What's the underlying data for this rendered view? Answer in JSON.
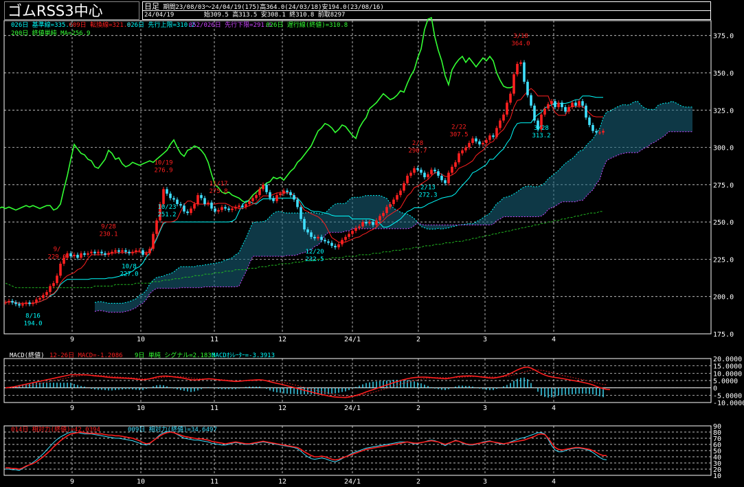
{
  "header": {
    "title": "ゴムRSS3中心",
    "period_type": "日足",
    "info": "期間23/08/03～24/04/19(175)高364.0(24/03/18)安194.0(23/08/16)",
    "date": "24/04/19",
    "ohlc": "始309.5 高313.5 安308.1 終310.8 前取8297"
  },
  "colors": {
    "background": "#000000",
    "up": "#ff2020",
    "down": "#40e0ff",
    "kijun": "#00ffff",
    "tenkan": "#ff2020",
    "senkou_a": "#00ffff",
    "senkou_b": "#cc44ff",
    "chikou": "#33ff33",
    "ma200": "#22bb22",
    "macd": "#ff2020",
    "signal": "#cc2222",
    "histogram": "#40e0ff",
    "rsi14": "#ff2020",
    "rsi9": "#40e0ff",
    "grid": "#ffffff"
  },
  "legend": {
    "l1": [
      "026日 基準線=335.6",
      "009日 転換線=321.0",
      "026日 先行上限=310.2",
      "052/026日 先行下限=291.6",
      "026日 遅行線(終値)=310.8"
    ],
    "l2": "200日 終値単純 MA=256.9",
    "macd": [
      "MACD(終値)",
      "12-26日 MACD=-1.2086",
      "9日 単純 シグナル=2.1833",
      "MACDｵｼﾚｰﾀｰ=-3.3913"
    ],
    "rsi": [
      "014日 相対力(終値)=42.0394",
      "009日 相対力(終値)=34.6497"
    ]
  },
  "chart_data": [
    {
      "type": "candlestick",
      "title": "ゴムRSS3中心",
      "ylim": [
        175,
        385
      ],
      "y_ticks": [
        "375.0",
        "350.0",
        "325.0",
        "300.0",
        "275.0",
        "250.0",
        "225.0",
        "200.0",
        "175.0"
      ],
      "x_ticks": [
        "9",
        "10",
        "11",
        "12",
        "24/1",
        "2",
        "3",
        "4"
      ],
      "annotations": [
        {
          "date": "8/16",
          "value": "194.0"
        },
        {
          "date": "9/",
          "value": "229.0"
        },
        {
          "date": "9/28",
          "value": "230.1"
        },
        {
          "date": "10/8",
          "value": "227.0"
        },
        {
          "date": "10/19",
          "value": "276.9"
        },
        {
          "date": "10/23",
          "value": "251.2"
        },
        {
          "date": "11/17",
          "value": "275.8"
        },
        {
          "date": "12/20",
          "value": "232.5"
        },
        {
          "date": "2/8",
          "value": "290.7"
        },
        {
          "date": "2/13",
          "value": "272.3"
        },
        {
          "date": "2/22",
          "value": "307.5"
        },
        {
          "date": "3/18",
          "value": "364.0"
        },
        {
          "date": "3/28",
          "value": "313.2"
        }
      ],
      "close": [
        196,
        197,
        196,
        195,
        194,
        195,
        196,
        195,
        196,
        198,
        199,
        201,
        203,
        207,
        209,
        214,
        222,
        226,
        229,
        227,
        228,
        226,
        229,
        228,
        229,
        230,
        229,
        230,
        229,
        228,
        229,
        230,
        231,
        230,
        231,
        230,
        229,
        230,
        231,
        231,
        228,
        229,
        232,
        242,
        251,
        262,
        272,
        269,
        266,
        265,
        262,
        261,
        257,
        256,
        259,
        262,
        268,
        266,
        262,
        263,
        259,
        257,
        258,
        260,
        259,
        258,
        259,
        260,
        261,
        260,
        262,
        264,
        266,
        268,
        272,
        275,
        270,
        266,
        264,
        268,
        269,
        271,
        270,
        268,
        265,
        260,
        252,
        245,
        243,
        240,
        239,
        240,
        238,
        237,
        236,
        234,
        233,
        235,
        238,
        240,
        242,
        244,
        246,
        247,
        250,
        249,
        250,
        248,
        251,
        254,
        256,
        260,
        262,
        265,
        268,
        271,
        276,
        281,
        283,
        286,
        285,
        283,
        280,
        282,
        285,
        284,
        281,
        278,
        276,
        283,
        287,
        290,
        296,
        298,
        300,
        303,
        306,
        304,
        302,
        303,
        305,
        308,
        307,
        313,
        318,
        322,
        330,
        336,
        349,
        356,
        357,
        344,
        335,
        328,
        318,
        312,
        322,
        326,
        329,
        331,
        327,
        330,
        327,
        324,
        327,
        330,
        328,
        331,
        328,
        320,
        315,
        311,
        310,
        310,
        311
      ],
      "ma200": [
        209,
        208,
        207,
        206,
        206,
        206,
        206,
        206,
        206,
        206,
        206,
        206,
        206,
        206,
        206,
        206,
        206,
        206,
        206,
        206,
        206,
        206,
        206,
        206,
        206,
        206,
        207,
        207,
        207,
        207,
        207,
        207,
        208,
        208,
        208,
        208,
        208,
        208,
        209,
        209,
        209,
        209,
        209,
        210,
        210,
        210,
        211,
        211,
        211,
        212,
        212,
        212,
        213,
        213,
        213,
        214,
        214,
        214,
        215,
        215,
        215,
        216,
        216,
        216,
        217,
        217,
        217,
        218,
        218,
        218,
        218,
        219,
        219,
        219,
        220,
        220,
        220,
        221,
        221,
        221,
        222,
        222,
        222,
        222,
        223,
        223,
        223,
        224,
        224,
        224,
        224,
        225,
        225,
        225,
        225,
        226,
        226,
        226,
        226,
        227,
        227,
        227,
        227,
        228,
        228,
        228,
        228,
        229,
        229,
        229,
        230,
        230,
        230,
        231,
        231,
        231,
        232,
        232,
        232,
        233,
        233,
        233,
        234,
        234,
        234,
        235,
        235,
        235,
        236,
        236,
        236,
        237,
        237,
        237,
        238,
        238,
        239,
        239,
        240,
        240,
        241,
        241,
        242,
        242,
        243,
        243,
        244,
        244,
        245,
        245,
        246,
        246,
        247,
        247,
        248,
        248,
        249,
        249,
        250,
        250,
        251,
        251,
        252,
        252,
        253,
        253,
        254,
        254,
        255,
        255,
        256,
        256,
        256,
        257,
        257
      ]
    },
    {
      "type": "line",
      "title": "MACD(終値)",
      "ylim": [
        -10,
        20
      ],
      "y_ticks": [
        "20.0000",
        "15.0000",
        "10.0000",
        "5.0000",
        "0",
        "-5.0000",
        "-10.0000"
      ],
      "series": [
        {
          "name": "MACD",
          "values": [
            0,
            0.3,
            0.6,
            1,
            1.5,
            2,
            2.5,
            3,
            3.5,
            4,
            4.5,
            5,
            5.5,
            6,
            6.5,
            7,
            7.5,
            8,
            8.5,
            9,
            9,
            9,
            9,
            9,
            8.8,
            8.5,
            8.2,
            8,
            7.8,
            7.5,
            7.2,
            7,
            6.9,
            6.8,
            6.7,
            6.6,
            6.5,
            6.3,
            6,
            5.7,
            5.5,
            5.8,
            6.2,
            6.8,
            7.4,
            7.8,
            8,
            8,
            7.8,
            7.5,
            7.2,
            6.9,
            6.5,
            6,
            5.5,
            5.4,
            5.5,
            5.7,
            6,
            6.2,
            6.1,
            5.8,
            5.5,
            5.2,
            5,
            4.8,
            4.6,
            4.4,
            4.5,
            4.7,
            5,
            5.2,
            5.3,
            5.4,
            5.5,
            5.3,
            4.8,
            4.2,
            3.6,
            3.1,
            2.6,
            2,
            1.4,
            0.8,
            0.2,
            -0.4,
            -1,
            -1.6,
            -2.2,
            -2.8,
            -3.4,
            -4,
            -4.5,
            -5,
            -5.5,
            -5.9,
            -6.2,
            -6.4,
            -6.5,
            -6.6,
            -6.3,
            -5.8,
            -5.2,
            -4.5,
            -3.7,
            -2.8,
            -2,
            -1.2,
            -0.4,
            0.4,
            1.2,
            2,
            2.8,
            3.6,
            4.3,
            5,
            5.6,
            6.2,
            6.7,
            7,
            7.2,
            7.3,
            7.3,
            7.2,
            7,
            6.8,
            6.6,
            6.4,
            6.2,
            6.5,
            6.9,
            7.4,
            7.8,
            8,
            8.1,
            8.2,
            8.1,
            7.9,
            7.6,
            7.3,
            7,
            6.8,
            6.7,
            7,
            7.5,
            8.1,
            8.8,
            9.8,
            11,
            12.2,
            13.2,
            14,
            14.2,
            13.5,
            12.3,
            11,
            9.8,
            8.8,
            8,
            7.5,
            7.1,
            6.8,
            6.4,
            6,
            5.5,
            5.1,
            4.7,
            4.3,
            3.8,
            3.3,
            2.7,
            2,
            1,
            0.2,
            -0.5,
            -1,
            -1.2
          ]
        },
        {
          "name": "Signal",
          "values": [
            0,
            0.1,
            0.2,
            0.4,
            0.6,
            0.9,
            1.2,
            1.6,
            2,
            2.4,
            2.9,
            3.4,
            3.9,
            4.4,
            4.9,
            5.4,
            5.9,
            6.4,
            6.9,
            7.4,
            7.8,
            8.1,
            8.4,
            8.6,
            8.8,
            8.8,
            8.7,
            8.6,
            8.4,
            8.2,
            8,
            7.8,
            7.6,
            7.4,
            7.2,
            7,
            6.9,
            6.8,
            6.6,
            6.4,
            6.2,
            6.1,
            6.1,
            6.3,
            6.6,
            6.9,
            7.2,
            7.5,
            7.6,
            7.7,
            7.7,
            7.6,
            7.4,
            7.1,
            6.8,
            6.5,
            6.3,
            6.1,
            6,
            6,
            6,
            5.9,
            5.8,
            5.6,
            5.4,
            5.2,
            5,
            4.8,
            4.7,
            4.7,
            4.7,
            4.8,
            4.9,
            5,
            5.1,
            5.2,
            5.1,
            5,
            4.8,
            4.5,
            4.1,
            3.7,
            3.2,
            2.7,
            2.1,
            1.6,
            1,
            0.4,
            -0.2,
            -0.8,
            -1.4,
            -2,
            -2.6,
            -3.1,
            -3.6,
            -4.1,
            -4.5,
            -4.9,
            -5.2,
            -5.5,
            -5.6,
            -5.6,
            -5.5,
            -5.2,
            -4.8,
            -4.3,
            -3.7,
            -3.1,
            -2.4,
            -1.7,
            -1,
            -0.3,
            0.4,
            1.1,
            1.8,
            2.5,
            3.2,
            3.8,
            4.4,
            5,
            5.5,
            5.9,
            6.3,
            6.6,
            6.8,
            7,
            7,
            7,
            6.9,
            6.9,
            6.9,
            7,
            7.1,
            7.3,
            7.5,
            7.6,
            7.7,
            7.8,
            7.8,
            7.7,
            7.6,
            7.5,
            7.4,
            7.3,
            7.4,
            7.6,
            7.9,
            8.3,
            8.8,
            9.4,
            10.1,
            10.8,
            11.5,
            12,
            12.2,
            12.2,
            12,
            11.6,
            11,
            10.4,
            9.8,
            9.2,
            8.6,
            8.1,
            7.6,
            7.1,
            6.6,
            6.1,
            5.6,
            5.1,
            4.6,
            4,
            3.4,
            2.8,
            2.4,
            2.2
          ]
        }
      ]
    },
    {
      "type": "line",
      "title": "相対力(終値)",
      "ylim": [
        10,
        90
      ],
      "y_ticks": [
        "90",
        "80",
        "70",
        "60",
        "50",
        "40",
        "30",
        "20",
        "10"
      ],
      "series": [
        {
          "name": "014日 相対力",
          "values": [
            22,
            22,
            21,
            21,
            20,
            22,
            25,
            27,
            29,
            32,
            36,
            40,
            45,
            50,
            56,
            61,
            66,
            70,
            74,
            77,
            78,
            79,
            80,
            79,
            78,
            78,
            78,
            77,
            77,
            76,
            75,
            75,
            74,
            74,
            73,
            72,
            71,
            70,
            68,
            66,
            63,
            61,
            62,
            66,
            70,
            74,
            77,
            79,
            80,
            79,
            77,
            75,
            73,
            72,
            71,
            70,
            69,
            69,
            68,
            67,
            65,
            64,
            63,
            62,
            61,
            62,
            63,
            64,
            63,
            62,
            61,
            61,
            62,
            63,
            64,
            65,
            64,
            63,
            62,
            61,
            60,
            59,
            58,
            57,
            56,
            55,
            52,
            48,
            45,
            42,
            40,
            40,
            41,
            40,
            38,
            36,
            35,
            36,
            38,
            40,
            42,
            44,
            46,
            48,
            50,
            52,
            53,
            54,
            55,
            56,
            57,
            58,
            59,
            60,
            61,
            62,
            63,
            64,
            63,
            62,
            62,
            63,
            64,
            65,
            66,
            65,
            64,
            62,
            60,
            62,
            64,
            66,
            65,
            63,
            61,
            60,
            60,
            61,
            62,
            63,
            64,
            65,
            64,
            63,
            62,
            61,
            62,
            63,
            64,
            65,
            66,
            67,
            69,
            71,
            73,
            76,
            77,
            76,
            70,
            62,
            55,
            52,
            51,
            52,
            53,
            54,
            55,
            55,
            54,
            53,
            52,
            50,
            47,
            44,
            42,
            42
          ]
        },
        {
          "name": "009日 相対力",
          "values": [
            20,
            20,
            19,
            19,
            18,
            21,
            24,
            27,
            31,
            35,
            40,
            45,
            51,
            57,
            63,
            68,
            72,
            75,
            78,
            80,
            80,
            79,
            78,
            77,
            77,
            77,
            76,
            75,
            74,
            73,
            72,
            71,
            70,
            70,
            69,
            68,
            67,
            66,
            64,
            62,
            60,
            59,
            61,
            66,
            71,
            76,
            79,
            81,
            81,
            79,
            76,
            73,
            70,
            69,
            68,
            67,
            67,
            66,
            65,
            64,
            62,
            61,
            60,
            59,
            59,
            60,
            62,
            63,
            62,
            61,
            60,
            60,
            61,
            62,
            63,
            64,
            63,
            62,
            61,
            60,
            59,
            58,
            57,
            56,
            55,
            53,
            49,
            44,
            40,
            37,
            36,
            37,
            38,
            37,
            35,
            33,
            32,
            34,
            37,
            40,
            43,
            46,
            48,
            50,
            52,
            54,
            55,
            56,
            57,
            58,
            59,
            60,
            61,
            62,
            63,
            64,
            64,
            64,
            62,
            61,
            61,
            63,
            64,
            66,
            67,
            66,
            64,
            61,
            58,
            61,
            64,
            67,
            65,
            62,
            60,
            59,
            59,
            60,
            62,
            64,
            65,
            66,
            64,
            62,
            61,
            60,
            62,
            64,
            66,
            68,
            70,
            71,
            73,
            75,
            77,
            79,
            79,
            77,
            68,
            58,
            51,
            48,
            48,
            50,
            52,
            53,
            54,
            54,
            53,
            52,
            50,
            47,
            43,
            39,
            36,
            35
          ]
        }
      ]
    }
  ]
}
